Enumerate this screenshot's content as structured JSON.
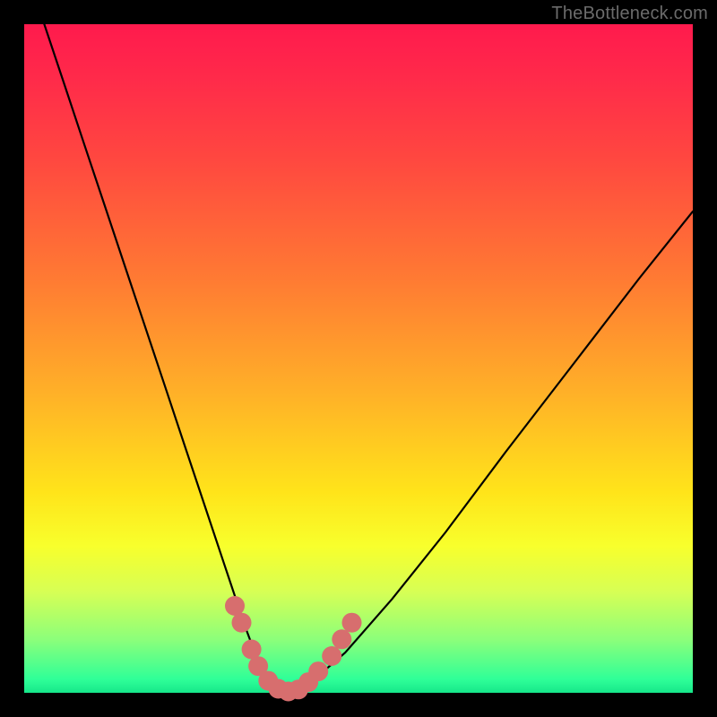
{
  "watermark": "TheBottleneck.com",
  "chart_data": {
    "type": "line",
    "title": "",
    "xlabel": "",
    "ylabel": "",
    "xlim": [
      0,
      100
    ],
    "ylim": [
      0,
      100
    ],
    "grid": false,
    "series": [
      {
        "name": "bottleneck-curve",
        "x": [
          3,
          6,
          9,
          12,
          15,
          18,
          21,
          24,
          27,
          30,
          33,
          34.5,
          36,
          37.5,
          39,
          42,
          48,
          55,
          63,
          72,
          82,
          92,
          100
        ],
        "y": [
          100,
          91,
          82,
          73,
          64,
          55,
          46,
          37,
          28,
          19,
          10,
          6,
          2.5,
          0.5,
          0,
          0.8,
          6,
          14,
          24,
          36,
          49,
          62,
          72
        ]
      }
    ],
    "markers": {
      "name": "highlight-dots",
      "color": "#d76e6e",
      "points": [
        {
          "x": 31.5,
          "y": 13
        },
        {
          "x": 32.5,
          "y": 10.5
        },
        {
          "x": 34,
          "y": 6.5
        },
        {
          "x": 35,
          "y": 4
        },
        {
          "x": 36.5,
          "y": 1.8
        },
        {
          "x": 38,
          "y": 0.6
        },
        {
          "x": 39.5,
          "y": 0.2
        },
        {
          "x": 41,
          "y": 0.5
        },
        {
          "x": 42.5,
          "y": 1.6
        },
        {
          "x": 44,
          "y": 3.2
        },
        {
          "x": 46,
          "y": 5.5
        },
        {
          "x": 47.5,
          "y": 8
        },
        {
          "x": 49,
          "y": 10.5
        }
      ]
    },
    "gradient_stops": [
      {
        "pos": 0,
        "color": "#ff1a4d"
      },
      {
        "pos": 20,
        "color": "#ff4740"
      },
      {
        "pos": 55,
        "color": "#ffb028"
      },
      {
        "pos": 78,
        "color": "#f8ff2c"
      },
      {
        "pos": 100,
        "color": "#16e78a"
      }
    ]
  }
}
